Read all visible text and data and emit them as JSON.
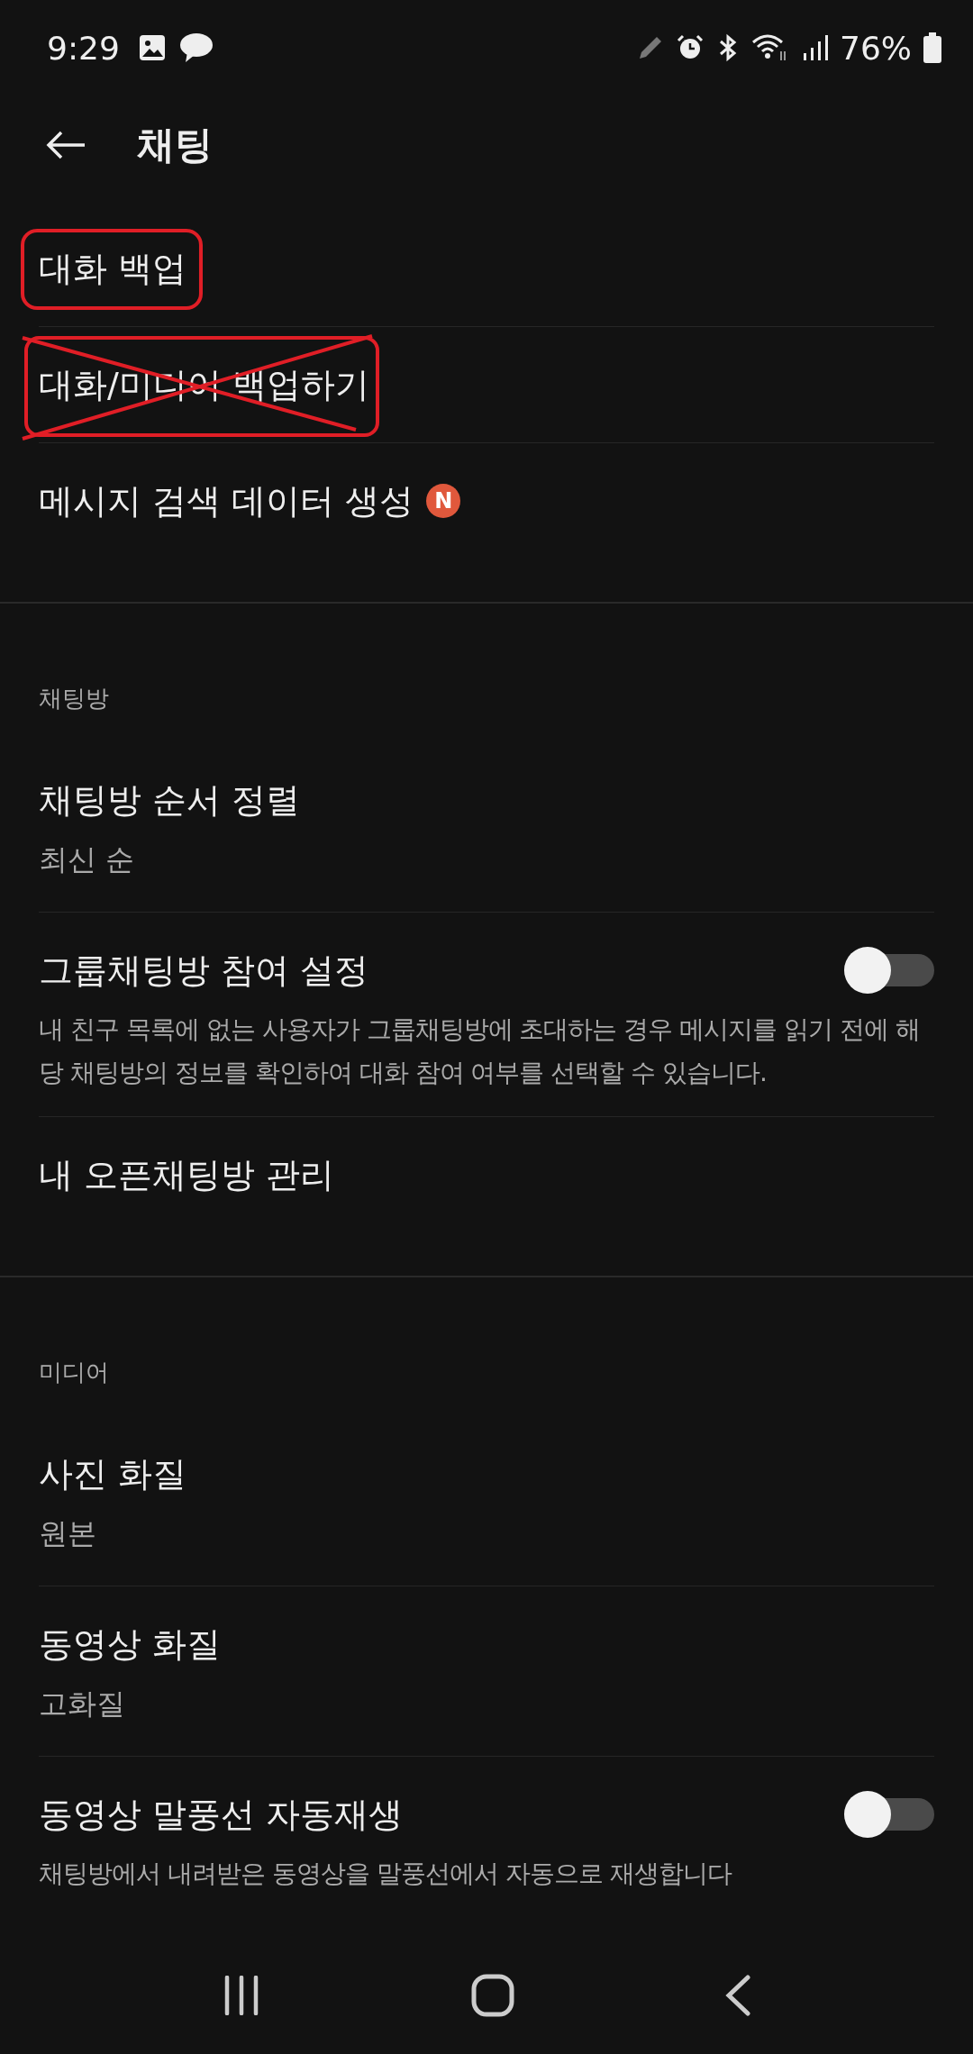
{
  "status_bar": {
    "time": "9:29",
    "battery": "76%"
  },
  "header": {
    "title": "채팅"
  },
  "sections": [
    {
      "items": [
        {
          "kind": "link",
          "title": "대화 백업",
          "circled": true
        },
        {
          "kind": "link",
          "title": "대화/미디어 백업하기",
          "crossed_out": true
        },
        {
          "kind": "link",
          "title": "메시지 검색 데이터 생성",
          "badge": {
            "text": "N",
            "color": "#e0583c"
          }
        }
      ]
    },
    {
      "header": "채팅방",
      "items": [
        {
          "kind": "link",
          "title": "채팅방 순서 정렬",
          "subtitle": "최신 순"
        },
        {
          "kind": "toggle",
          "title": "그룹채팅방 참여 설정",
          "on": false,
          "description": "내 친구 목록에 없는 사용자가 그룹채팅방에 초대하는 경우 메시지를 읽기 전에 해당 채팅방의 정보를 확인하여 대화 참여 여부를 선택할 수 있습니다."
        },
        {
          "kind": "link",
          "title": "내 오픈채팅방 관리"
        }
      ]
    },
    {
      "header": "미디어",
      "items": [
        {
          "kind": "link",
          "title": "사진 화질",
          "subtitle": "원본"
        },
        {
          "kind": "link",
          "title": "동영상 화질",
          "subtitle": "고화질"
        },
        {
          "kind": "toggle",
          "title": "동영상 말풍선 자동재생",
          "on": false,
          "description": "채팅방에서 내려받은 동영상을 말풍선에서 자동으로 재생합니다"
        }
      ]
    }
  ]
}
